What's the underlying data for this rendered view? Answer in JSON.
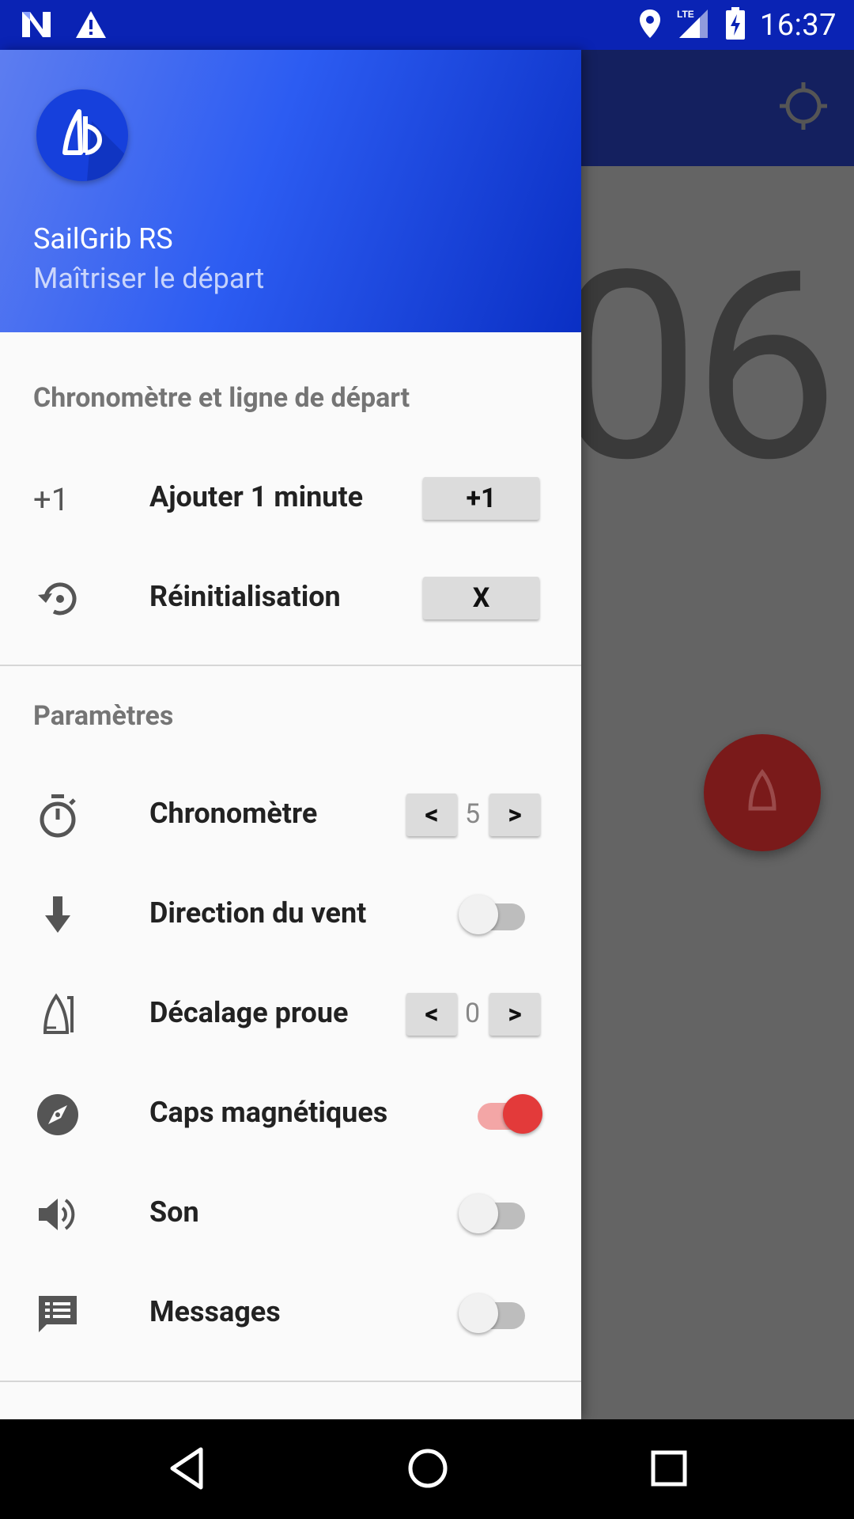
{
  "status_bar": {
    "time": "16:37",
    "left_icons": [
      "n-notification-icon",
      "warning-icon"
    ],
    "right_icons": [
      "location-icon",
      "lte-signal-icon",
      "battery-charging-icon"
    ],
    "network": "LTE"
  },
  "background": {
    "timer_text": "06",
    "appbar_icon": "gps-target-icon"
  },
  "drawer": {
    "header": {
      "app_name": "SailGrib RS",
      "subtitle": "Maîtriser le départ"
    },
    "section_timer": {
      "title": "Chronomètre et ligne de départ",
      "items": [
        {
          "icon": "plus-one-icon",
          "icon_text": "+1",
          "label": "Ajouter 1 minute",
          "button": "+1"
        },
        {
          "icon": "reset-icon",
          "label": "Réinitialisation",
          "button": "X"
        }
      ]
    },
    "section_params": {
      "title": "Paramètres",
      "chronometre": {
        "label": "Chronomètre",
        "value": "5",
        "dec": "<",
        "inc": ">"
      },
      "wind": {
        "label": "Direction du vent",
        "on": false
      },
      "bow": {
        "label": "Décalage proue",
        "value": "0",
        "dec": "<",
        "inc": ">"
      },
      "magnetic": {
        "label": "Caps magnétiques",
        "on": true
      },
      "sound": {
        "label": "Son",
        "on": false
      },
      "messages": {
        "label": "Messages",
        "on": false
      }
    }
  },
  "colors": {
    "status_bar": "#0a23b4",
    "accent": "#e33a3a",
    "header_start": "#5d7df0",
    "header_end": "#0a2fc4"
  }
}
